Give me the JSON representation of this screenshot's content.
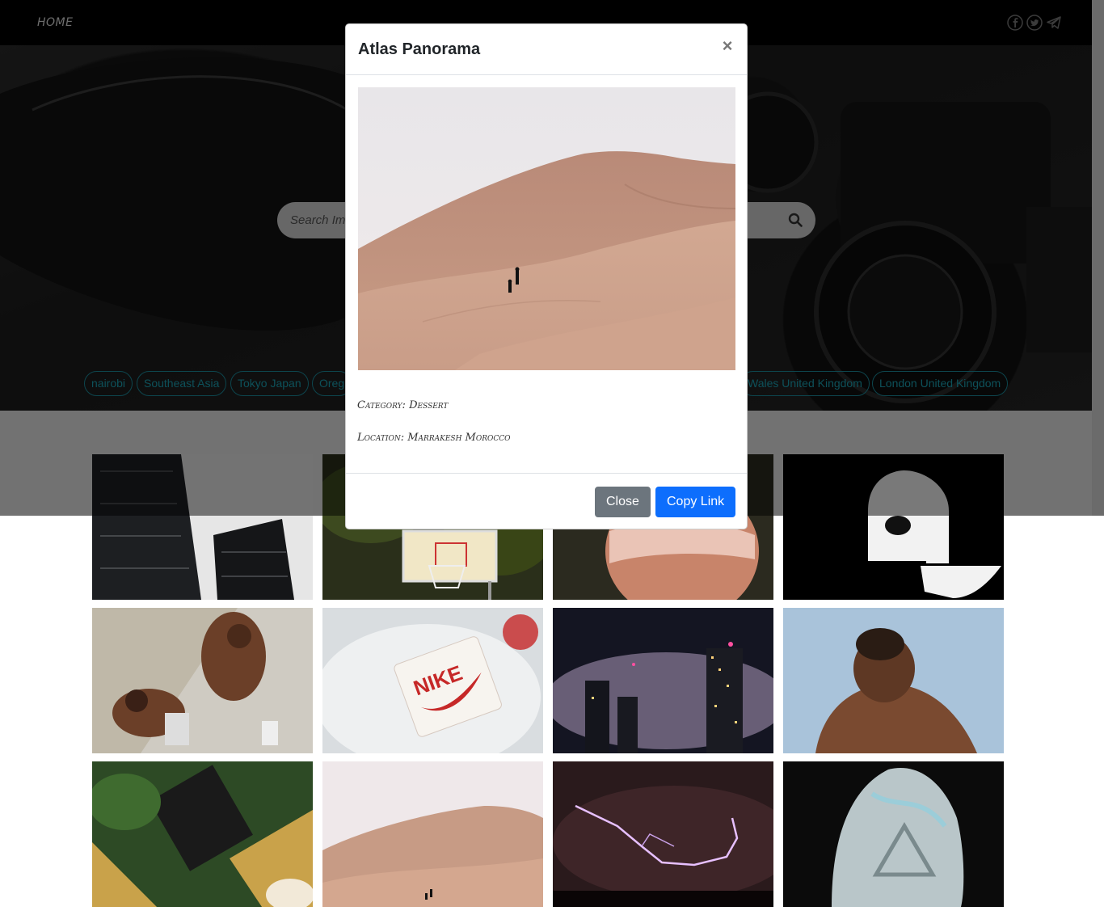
{
  "nav": {
    "home": "HOME",
    "social": [
      "facebook-icon",
      "twitter-icon",
      "telegram-icon"
    ]
  },
  "search": {
    "placeholder": "Search Im"
  },
  "tags": [
    "nairobi",
    "Southeast Asia",
    "Tokyo Japan",
    "Oreg",
    "Wales United Kingdom",
    "London United Kingdom"
  ],
  "modal": {
    "title": "Atlas Panorama",
    "close_symbol": "×",
    "category_label": "Category:",
    "category_value": "Dessert",
    "location_label": "Location:",
    "location_value": "Marrakesh Morocco",
    "close_button": "Close",
    "copy_button": "Copy Link"
  },
  "gallery": [
    "skyscrapers",
    "basketball-hoop",
    "lace-underwear",
    "ape-head-logo",
    "boxers-resting",
    "nike-air-max-tag",
    "foggy-city-night",
    "man-back-portrait",
    "garden-aerial",
    "desert-dunes",
    "lightning-storm",
    "reflective-jacket"
  ],
  "colors": {
    "tag": "#1aa0b2",
    "primary": "#0d6efd",
    "secondary": "#6c757d"
  }
}
